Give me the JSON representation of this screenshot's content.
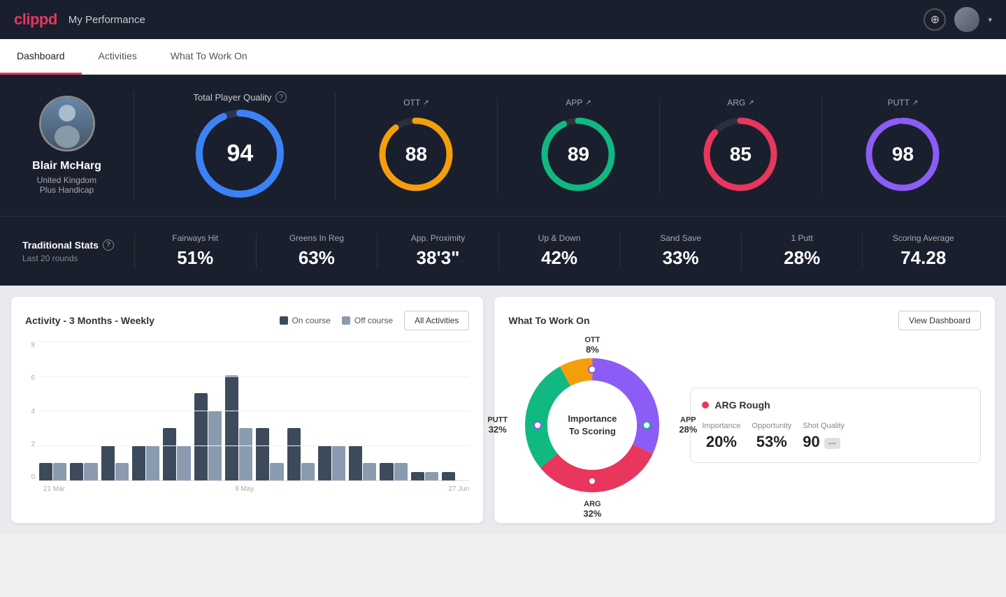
{
  "header": {
    "logo": "clippd",
    "title": "My Performance",
    "add_button_icon": "+",
    "user_menu_chevron": "▾"
  },
  "nav": {
    "tabs": [
      {
        "id": "dashboard",
        "label": "Dashboard",
        "active": true
      },
      {
        "id": "activities",
        "label": "Activities",
        "active": false
      },
      {
        "id": "what-to-work-on",
        "label": "What To Work On",
        "active": false
      }
    ]
  },
  "hero": {
    "profile": {
      "name": "Blair McHarg",
      "country": "United Kingdom",
      "handicap": "Plus Handicap"
    },
    "total_quality": {
      "label": "Total Player Quality",
      "value": 94,
      "color": "#3b82f6"
    },
    "scores": [
      {
        "id": "ott",
        "label": "OTT",
        "value": 88,
        "color": "#f59e0b"
      },
      {
        "id": "app",
        "label": "APP",
        "value": 89,
        "color": "#10b981"
      },
      {
        "id": "arg",
        "label": "ARG",
        "value": 85,
        "color": "#e8365d"
      },
      {
        "id": "putt",
        "label": "PUTT",
        "value": 98,
        "color": "#8b5cf6"
      }
    ]
  },
  "traditional_stats": {
    "label": "Traditional Stats",
    "sublabel": "Last 20 rounds",
    "items": [
      {
        "name": "Fairways Hit",
        "value": "51%"
      },
      {
        "name": "Greens In Reg",
        "value": "63%"
      },
      {
        "name": "App. Proximity",
        "value": "38'3\""
      },
      {
        "name": "Up & Down",
        "value": "42%"
      },
      {
        "name": "Sand Save",
        "value": "33%"
      },
      {
        "name": "1 Putt",
        "value": "28%"
      },
      {
        "name": "Scoring Average",
        "value": "74.28"
      }
    ]
  },
  "activity_chart": {
    "title": "Activity - 3 Months - Weekly",
    "legend": [
      {
        "label": "On course",
        "color": "#3d4a5c"
      },
      {
        "label": "Off course",
        "color": "#8a9bb0"
      }
    ],
    "all_activities_btn": "All Activities",
    "y_labels": [
      "8",
      "6",
      "4",
      "2",
      "0"
    ],
    "x_labels": [
      "21 Mar",
      "",
      "9 May",
      "",
      "27 Jun"
    ],
    "bars": [
      {
        "on": 1,
        "off": 1
      },
      {
        "on": 1,
        "off": 1
      },
      {
        "on": 2,
        "off": 1
      },
      {
        "on": 2,
        "off": 2
      },
      {
        "on": 3,
        "off": 2
      },
      {
        "on": 5,
        "off": 4
      },
      {
        "on": 6,
        "off": 3
      },
      {
        "on": 3,
        "off": 1
      },
      {
        "on": 3,
        "off": 1
      },
      {
        "on": 2,
        "off": 2
      },
      {
        "on": 2,
        "off": 1
      },
      {
        "on": 1,
        "off": 1
      },
      {
        "on": 0.5,
        "off": 0.5
      },
      {
        "on": 0.5,
        "off": 0
      }
    ]
  },
  "what_to_work_on": {
    "title": "What To Work On",
    "view_dashboard_btn": "View Dashboard",
    "donut_center": [
      "Importance",
      "To Scoring"
    ],
    "segments": [
      {
        "label": "OTT",
        "pct": "8%",
        "color": "#f59e0b"
      },
      {
        "label": "APP",
        "pct": "28%",
        "color": "#10b981"
      },
      {
        "label": "ARG",
        "pct": "32%",
        "color": "#e8365d"
      },
      {
        "label": "PUTT",
        "pct": "32%",
        "color": "#8b5cf6"
      }
    ],
    "detail": {
      "category": "ARG Rough",
      "dot_color": "#e8365d",
      "metrics": [
        {
          "label": "Importance",
          "value": "20%"
        },
        {
          "label": "Opportunity",
          "value": "53%"
        },
        {
          "label": "Shot Quality",
          "value": "90"
        }
      ]
    }
  }
}
